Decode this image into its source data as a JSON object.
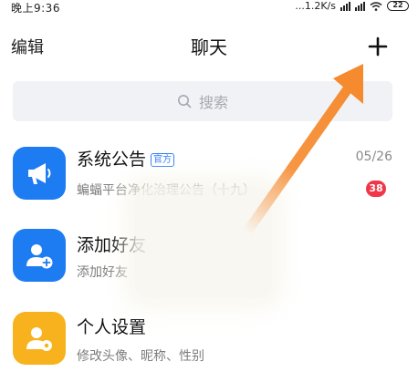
{
  "status_bar": {
    "time": "晚上9:36",
    "network_speed": "...1.2K/s",
    "battery": "22"
  },
  "header": {
    "edit_label": "编辑",
    "title": "聊天",
    "add_icon": "plus-icon"
  },
  "search": {
    "placeholder": "搜索",
    "icon": "search-icon"
  },
  "chats": [
    {
      "title": "系统公告",
      "tag": "官方",
      "subtitle": "蝙蝠平台净化治理公告（十九）",
      "date": "05/26",
      "unread": "38",
      "icon": "megaphone-icon",
      "color": "#1e7cf2"
    },
    {
      "title": "添加好友",
      "subtitle": "添加好友",
      "icon": "add-user-icon",
      "color": "#1e7cf2"
    },
    {
      "title": "个人设置",
      "subtitle": "修改头像、昵称、性别",
      "icon": "user-settings-icon",
      "color": "#f7b21e"
    }
  ],
  "annotation": {
    "arrow_color": "#f58a2e"
  }
}
